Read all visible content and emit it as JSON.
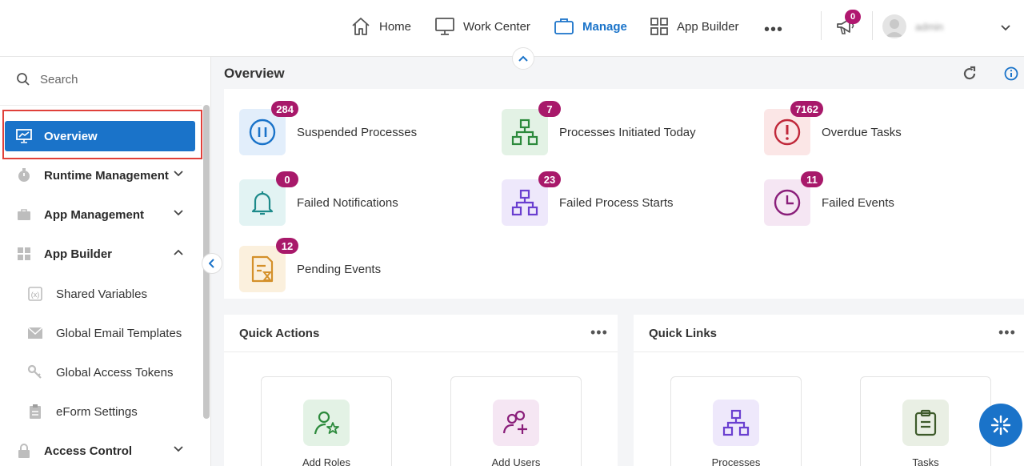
{
  "topnav": {
    "home": "Home",
    "work_center": "Work Center",
    "manage": "Manage",
    "app_builder": "App Builder",
    "more": "•••",
    "notifications_count": "0",
    "username": "admin",
    "active_color": "#1a73c9"
  },
  "sidebar": {
    "search_placeholder": "Search",
    "items": [
      {
        "label": "Overview",
        "icon": "monitor-chart-icon",
        "active": true
      },
      {
        "label": "Runtime Management",
        "icon": "stopwatch-icon"
      },
      {
        "label": "App Management",
        "icon": "briefcase-icon"
      },
      {
        "label": "App Builder",
        "icon": "grid-icon",
        "expanded": true
      },
      {
        "label": "Access Control",
        "icon": "lock-icon"
      }
    ],
    "sub_items": [
      {
        "label": "Shared Variables",
        "icon": "variable-icon"
      },
      {
        "label": "Global Email Templates",
        "icon": "envelope-icon"
      },
      {
        "label": "Global Access Tokens",
        "icon": "keys-icon"
      },
      {
        "label": "eForm Settings",
        "icon": "clipboard-icon"
      }
    ]
  },
  "main": {
    "title": "Overview",
    "stats": [
      {
        "label": "Suspended Processes",
        "count": "284",
        "icon": "pause-icon"
      },
      {
        "label": "Processes Initiated Today",
        "count": "7",
        "icon": "process-tree-icon"
      },
      {
        "label": "Overdue Tasks",
        "count": "7162",
        "icon": "exclamation-icon"
      },
      {
        "label": "Failed Notifications",
        "count": "0",
        "icon": "bell-icon"
      },
      {
        "label": "Failed Process Starts",
        "count": "23",
        "icon": "process-tree-icon"
      },
      {
        "label": "Failed Events",
        "count": "11",
        "icon": "clock-icon"
      },
      {
        "label": "Pending Events",
        "count": "12",
        "icon": "document-hourglass-icon"
      }
    ],
    "quick_actions": {
      "title": "Quick Actions",
      "items": [
        {
          "label": "Add Roles",
          "icon": "user-star-icon"
        },
        {
          "label": "Add Users",
          "icon": "users-add-icon"
        }
      ]
    },
    "quick_links": {
      "title": "Quick Links",
      "items": [
        {
          "label": "Processes",
          "icon": "process-tree-icon"
        },
        {
          "label": "Tasks",
          "icon": "clipboard-list-icon"
        }
      ]
    }
  }
}
